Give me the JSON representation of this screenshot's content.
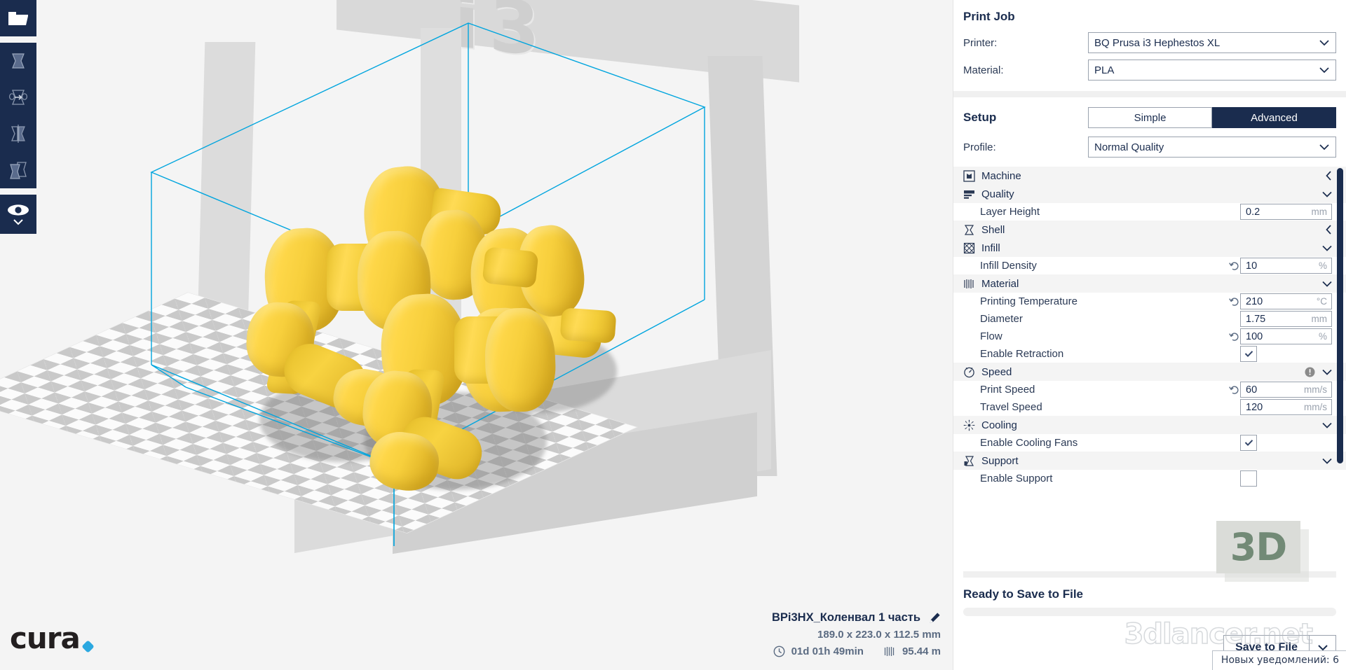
{
  "app": {
    "logo_text": "cura",
    "accent_color": "#2ba8e0",
    "navy_color": "#1a2c4e"
  },
  "toolbar": {
    "items": [
      {
        "name": "open-file",
        "icon": "folder-open-icon"
      },
      {
        "name": "move",
        "icon": "move-tool-icon"
      },
      {
        "name": "scale",
        "icon": "scale-tool-icon"
      },
      {
        "name": "mirror",
        "icon": "mirror-tool-icon"
      },
      {
        "name": "per-model-settings",
        "icon": "per-model-settings-icon"
      },
      {
        "name": "view-mode",
        "icon": "eye-icon"
      }
    ]
  },
  "model_info": {
    "name": "BPi3HX_Коленвал 1 часть",
    "dimensions": "189.0 x 223.0 x 112.5 mm",
    "print_time": "01d 01h 49min",
    "material_length": "95.44 m"
  },
  "viewport": {
    "printer_label": "i3",
    "build_volume_color": "#00a5de",
    "model_color": "#f5cf3a"
  },
  "panel": {
    "print_job_title": "Print Job",
    "printer_label": "Printer:",
    "printer_value": "BQ Prusa i3 Hephestos XL",
    "material_label": "Material:",
    "material_value": "PLA",
    "setup_title": "Setup",
    "tab_simple": "Simple",
    "tab_advanced": "Advanced",
    "active_tab": "Advanced",
    "profile_label": "Profile:",
    "profile_value": "Normal Quality",
    "ready_text": "Ready to Save to File",
    "save_button": "Save to File",
    "progress_percent": 0
  },
  "settings": [
    {
      "kind": "category",
      "label": "Machine",
      "icon": "machine-icon",
      "state": "collapsed"
    },
    {
      "kind": "category",
      "label": "Quality",
      "icon": "quality-icon",
      "state": "expanded"
    },
    {
      "kind": "setting",
      "label": "Layer Height",
      "value": "0.2",
      "unit": "mm",
      "revert": false
    },
    {
      "kind": "category",
      "label": "Shell",
      "icon": "shell-icon",
      "state": "collapsed"
    },
    {
      "kind": "category",
      "label": "Infill",
      "icon": "infill-icon",
      "state": "expanded"
    },
    {
      "kind": "setting",
      "label": "Infill Density",
      "value": "10",
      "unit": "%",
      "revert": true
    },
    {
      "kind": "category",
      "label": "Material",
      "icon": "material-icon",
      "state": "expanded"
    },
    {
      "kind": "setting",
      "label": "Printing Temperature",
      "value": "210",
      "unit": "°C",
      "revert": true
    },
    {
      "kind": "setting",
      "label": "Diameter",
      "value": "1.75",
      "unit": "mm",
      "revert": false
    },
    {
      "kind": "setting",
      "label": "Flow",
      "value": "100",
      "unit": "%",
      "revert": true
    },
    {
      "kind": "checkbox",
      "label": "Enable Retraction",
      "checked": true
    },
    {
      "kind": "category",
      "label": "Speed",
      "icon": "speed-icon",
      "state": "expanded",
      "warning": true
    },
    {
      "kind": "setting",
      "label": "Print Speed",
      "value": "60",
      "unit": "mm/s",
      "revert": true
    },
    {
      "kind": "setting",
      "label": "Travel Speed",
      "value": "120",
      "unit": "mm/s",
      "revert": false
    },
    {
      "kind": "category",
      "label": "Cooling",
      "icon": "cooling-icon",
      "state": "expanded"
    },
    {
      "kind": "checkbox",
      "label": "Enable Cooling Fans",
      "checked": true
    },
    {
      "kind": "category",
      "label": "Support",
      "icon": "support-icon",
      "state": "expanded"
    },
    {
      "kind": "checkbox",
      "label": "Enable Support",
      "checked": false
    }
  ],
  "watermarks": {
    "badge": "3D",
    "site": "3dlancer.net",
    "notification": "Новых уведомлений: 6"
  }
}
